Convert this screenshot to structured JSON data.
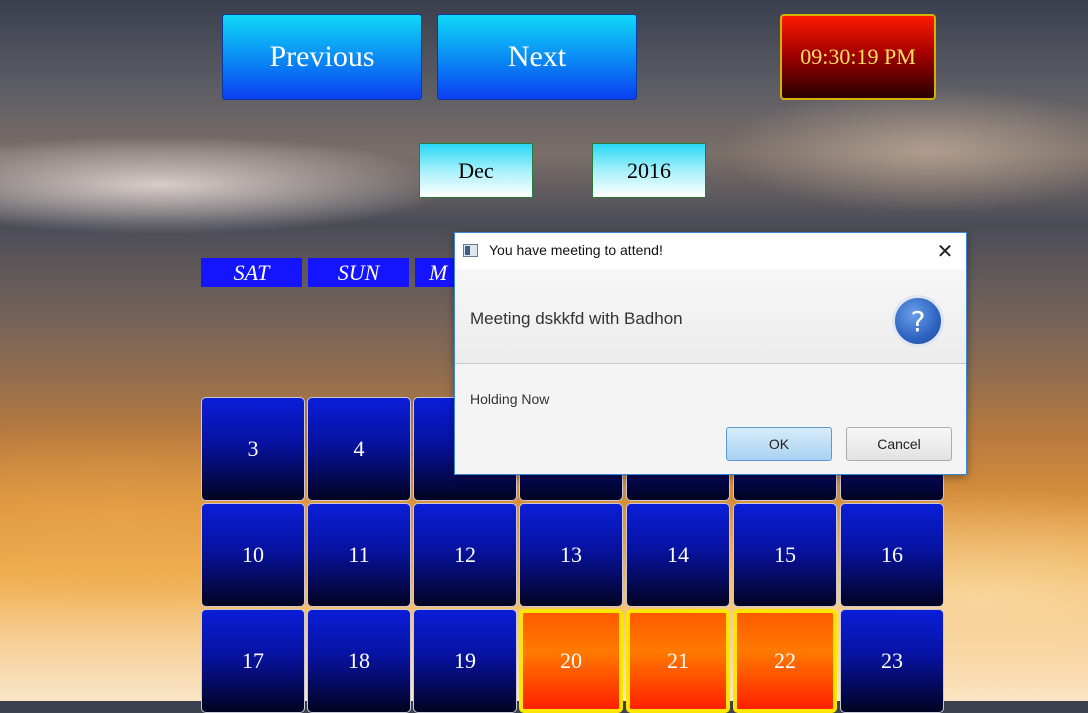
{
  "nav": {
    "previous_label": "Previous",
    "next_label": "Next"
  },
  "clock": {
    "time": "09:30:19 PM"
  },
  "selection": {
    "month": "Dec",
    "year": "2016"
  },
  "day_headers": [
    "SAT",
    "SUN",
    "M"
  ],
  "calendar": {
    "row1": [
      "3",
      "4"
    ],
    "row2": [
      "10",
      "11",
      "12",
      "13",
      "14",
      "15",
      "16"
    ],
    "row3": [
      "17",
      "18",
      "19",
      "20",
      "21",
      "22",
      "23"
    ],
    "highlighted_days": [
      "20",
      "21",
      "22"
    ]
  },
  "dialog": {
    "title": "You have meeting to attend!",
    "close_glyph": "✕",
    "message": "Meeting dskkfd with Badhon",
    "question_glyph": "?",
    "content": "Holding Now",
    "ok_label": "OK",
    "cancel_label": "Cancel"
  },
  "colors": {
    "day_cell": "#0712a0",
    "highlight_cell": "#ff7a00",
    "highlight_border": "#ffe600",
    "clock_bg": "#a50000"
  }
}
